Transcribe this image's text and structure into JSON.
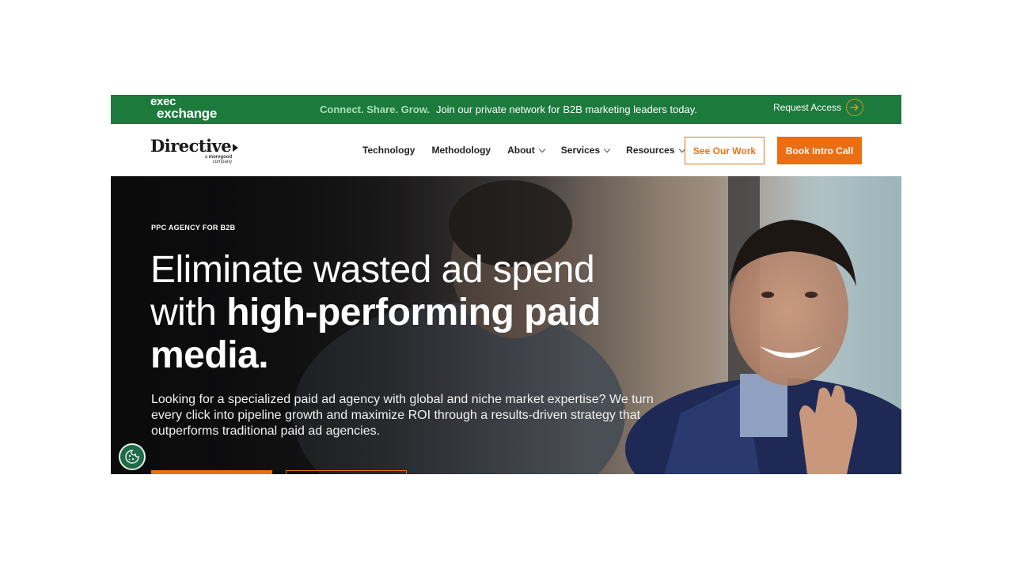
{
  "banner": {
    "logo_line1": "exec",
    "logo_line2": "exchange",
    "tagline_accent": "Connect. Share. Grow.",
    "tagline_text": "Join our private network for B2B marketing leaders today.",
    "cta_label": "Request Access",
    "colors": {
      "background": "#1c7a3c",
      "accent": "#a8e0b4",
      "cta_ring": "#f08a2a"
    }
  },
  "nav": {
    "brand_name": "Directive",
    "brand_sub_prefix": "a",
    "brand_sub_name": "moregood",
    "brand_sub_suffix": "company",
    "links": [
      {
        "label": "Technology",
        "has_dropdown": false
      },
      {
        "label": "Methodology",
        "has_dropdown": false
      },
      {
        "label": "About",
        "has_dropdown": true
      },
      {
        "label": "Services",
        "has_dropdown": true
      },
      {
        "label": "Resources",
        "has_dropdown": true
      }
    ],
    "secondary_cta": "See Our Work",
    "primary_cta": "Book Intro Call",
    "colors": {
      "primary": "#ec6e12"
    }
  },
  "hero": {
    "eyebrow": "PPC AGENCY FOR B2B",
    "headline_light": "Eliminate wasted ad spend with",
    "headline_bold": "high-performing paid media.",
    "lede": "Looking for a specialized paid ad agency with global and niche market expertise? We turn every click into pipeline growth and maximize ROI through a results-driven strategy that outperforms traditional paid ad agencies."
  },
  "icons": {
    "request_access": "arrow-right-circle-icon",
    "cookie": "cookie-icon",
    "dropdown": "chevron-down-icon"
  }
}
